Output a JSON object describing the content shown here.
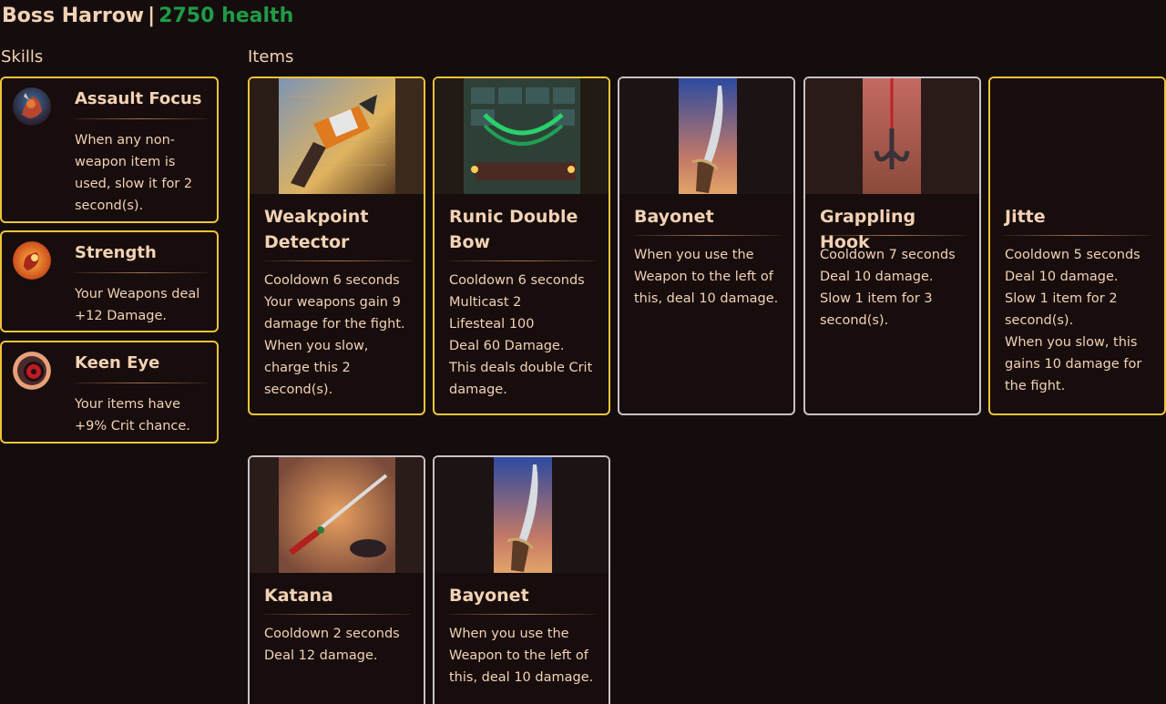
{
  "header": {
    "boss_name": "Boss Harrow",
    "separator": "|",
    "health_text": "2750 health"
  },
  "sections": {
    "skills_label": "Skills",
    "items_label": "Items"
  },
  "skills": [
    {
      "title": "Assault Focus",
      "icon": "assault-focus-icon",
      "description": "When any non-weapon item is used, slow it for 2 second(s)."
    },
    {
      "title": "Strength",
      "icon": "strength-icon",
      "description": "Your Weapons deal +12 Damage."
    },
    {
      "title": "Keen Eye",
      "icon": "keen-eye-icon",
      "description": "Your items have +9% Crit chance."
    }
  ],
  "items": [
    {
      "title": "Weakpoint Detector",
      "rarity_border": "#f0c43a",
      "art": "weakpoint-detector-art",
      "lines": [
        "Cooldown 6 seconds",
        "Your weapons gain 9 damage for the fight.",
        "When you slow, charge this 2 second(s)."
      ]
    },
    {
      "title": "Runic Double Bow",
      "rarity_border": "#f0c43a",
      "art": "runic-double-bow-art",
      "lines": [
        "Cooldown 6 seconds",
        "Multicast 2",
        "Lifesteal 100",
        "Deal 60 Damage.",
        "This deals double Crit damage."
      ]
    },
    {
      "title": "Bayonet",
      "rarity_border": "#c8c2c4",
      "art": "bayonet-art",
      "lines": [
        "When you use the Weapon to the left of this, deal 10 damage."
      ]
    },
    {
      "title": "Grappling Hook",
      "rarity_border": "#c8c2c4",
      "art": "grappling-hook-art",
      "lines": [
        "Cooldown 7 seconds",
        "Deal 10 damage.",
        "Slow 1 item for 3 second(s)."
      ]
    },
    {
      "title": "Jitte",
      "rarity_border": "#f0c43a",
      "art": "jitte-art",
      "lines": [
        "Cooldown 5 seconds",
        "Deal 10 damage.",
        "Slow 1 item for 2 second(s).",
        "When you slow, this gains 10 damage for the fight."
      ]
    },
    {
      "title": "Katana",
      "rarity_border": "#c8c2c4",
      "art": "katana-art",
      "lines": [
        "Cooldown 2 seconds",
        "Deal 12 damage."
      ]
    },
    {
      "title": "Bayonet",
      "rarity_border": "#c8c2c4",
      "art": "bayonet-art",
      "lines": [
        "When you use the Weapon to the left of this, deal 10 damage."
      ]
    }
  ],
  "colors": {
    "background": "#150d0d",
    "text": "#f3d2b4",
    "health": "#1f9b47",
    "gold_border": "#f0c43a",
    "silver_border": "#c8c2c4"
  }
}
